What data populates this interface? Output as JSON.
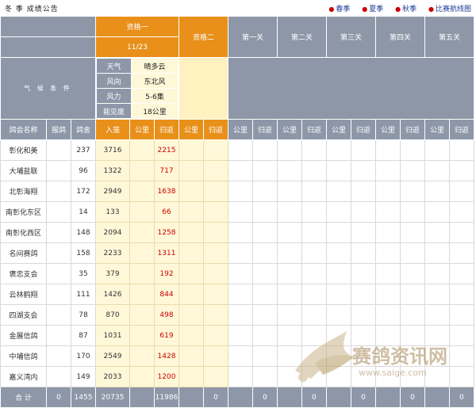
{
  "header": {
    "title": "冬 季 成绩公告",
    "links": [
      "春季",
      "夏季",
      "秋季",
      "比赛航线图"
    ]
  },
  "qualifier1": {
    "label": "资格一",
    "date": "11/23"
  },
  "qualifier2": {
    "label": "资格二"
  },
  "stages": [
    "第一关",
    "第二关",
    "第三关",
    "第四关",
    "第五关"
  ],
  "weather_label": "气 候 条 件",
  "weather": [
    {
      "k": "天气",
      "v": "晴多云"
    },
    {
      "k": "风向",
      "v": "东北风"
    },
    {
      "k": "风力",
      "v": "5-6集"
    },
    {
      "k": "能见度",
      "v": "18公里"
    }
  ],
  "columns": {
    "name": "鸽会名称",
    "reg": "报鸽",
    "loft": "鸽舍",
    "entry": "入笼",
    "km": "公里",
    "ret": "归返"
  },
  "rows": [
    {
      "name": "彰化和美",
      "reg": "",
      "loft": "237",
      "entry": "3716",
      "km": "",
      "ret": "2215"
    },
    {
      "name": "大埔盐联",
      "reg": "",
      "loft": "96",
      "entry": "1322",
      "km": "",
      "ret": "717"
    },
    {
      "name": "北彰海翔",
      "reg": "",
      "loft": "172",
      "entry": "2949",
      "km": "",
      "ret": "1638"
    },
    {
      "name": "南彰化东区",
      "reg": "",
      "loft": "14",
      "entry": "133",
      "km": "",
      "ret": "66"
    },
    {
      "name": "南彰化西区",
      "reg": "",
      "loft": "148",
      "entry": "2094",
      "km": "",
      "ret": "1258"
    },
    {
      "name": "名间赛鸽",
      "reg": "",
      "loft": "158",
      "entry": "2233",
      "km": "",
      "ret": "1311"
    },
    {
      "name": "褒忠支会",
      "reg": "",
      "loft": "35",
      "entry": "379",
      "km": "",
      "ret": "192"
    },
    {
      "name": "云林鹤翔",
      "reg": "",
      "loft": "111",
      "entry": "1426",
      "km": "",
      "ret": "844"
    },
    {
      "name": "四湖支会",
      "reg": "",
      "loft": "78",
      "entry": "870",
      "km": "",
      "ret": "498"
    },
    {
      "name": "金展信鸽",
      "reg": "",
      "loft": "87",
      "entry": "1031",
      "km": "",
      "ret": "619"
    },
    {
      "name": "中埔信鸽",
      "reg": "",
      "loft": "170",
      "entry": "2549",
      "km": "",
      "ret": "1428"
    },
    {
      "name": "嘉义湾内",
      "reg": "",
      "loft": "149",
      "entry": "2033",
      "km": "",
      "ret": "1200"
    }
  ],
  "footer": {
    "label": "合 计",
    "reg": "0",
    "loft": "1455",
    "entry": "20735",
    "ret": "11986",
    "q2": "0",
    "s1": "0",
    "s2": "0",
    "s3": "0",
    "s4": "0",
    "s5": "0"
  },
  "watermark": {
    "brand": "赛鸽资讯网",
    "url": "www.saige.com"
  }
}
